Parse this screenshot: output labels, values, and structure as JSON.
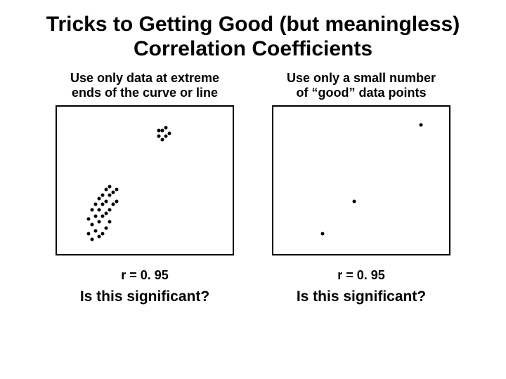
{
  "title": "Tricks to Getting Good (but meaningless) Correlation Coefficients",
  "left": {
    "subtitle_l1": "Use only data at extreme",
    "subtitle_l2": "ends of the curve or line",
    "r_label": "r = 0. 95",
    "sig_label": "Is this significant?"
  },
  "right": {
    "subtitle_l1": "Use only a small number",
    "subtitle_l2": "of “good” data points",
    "r_label": "r = 0. 95",
    "sig_label": "Is this significant?"
  },
  "chart_data": [
    {
      "type": "scatter",
      "title": "Use only data at extreme ends of the curve or line",
      "xlabel": "",
      "ylabel": "",
      "xlim": [
        0,
        100
      ],
      "ylim": [
        0,
        100
      ],
      "series": [
        {
          "name": "points",
          "values": [
            [
              20,
              10
            ],
            [
              24,
              12
            ],
            [
              18,
              14
            ],
            [
              22,
              16
            ],
            [
              26,
              14
            ],
            [
              28,
              18
            ],
            [
              24,
              22
            ],
            [
              20,
              20
            ],
            [
              22,
              26
            ],
            [
              18,
              24
            ],
            [
              26,
              26
            ],
            [
              30,
              22
            ],
            [
              28,
              28
            ],
            [
              24,
              30
            ],
            [
              20,
              30
            ],
            [
              30,
              30
            ],
            [
              26,
              34
            ],
            [
              22,
              34
            ],
            [
              28,
              36
            ],
            [
              32,
              34
            ],
            [
              24,
              38
            ],
            [
              30,
              40
            ],
            [
              26,
              40
            ],
            [
              34,
              36
            ],
            [
              32,
              42
            ],
            [
              28,
              44
            ],
            [
              34,
              44
            ],
            [
              30,
              46
            ],
            [
              60,
              78
            ],
            [
              58,
              80
            ],
            [
              62,
              80
            ],
            [
              64,
              82
            ],
            [
              60,
              84
            ],
            [
              58,
              84
            ],
            [
              62,
              86
            ]
          ]
        }
      ]
    },
    {
      "type": "scatter",
      "title": "Use only a small number of “good” data points",
      "xlabel": "",
      "ylabel": "",
      "xlim": [
        0,
        100
      ],
      "ylim": [
        0,
        100
      ],
      "series": [
        {
          "name": "points",
          "values": [
            [
              28,
              14
            ],
            [
              46,
              36
            ],
            [
              84,
              88
            ]
          ]
        }
      ]
    }
  ]
}
